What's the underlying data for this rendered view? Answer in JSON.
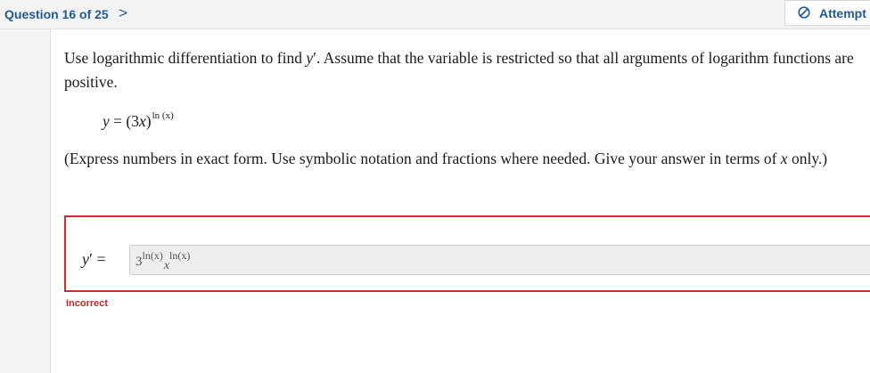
{
  "header": {
    "question_counter": "Question 16 of 25",
    "next_icon": "chevron-right-icon",
    "next_glyph": ">",
    "attempt_icon": "prohibited-icon",
    "attempt_label": "Attempt"
  },
  "question": {
    "prompt_part1": "Use logarithmic differentiation to find ",
    "prompt_var": "y",
    "prompt_prime": "′",
    "prompt_part2": ". Assume that the variable is restricted so that all arguments of logarithm functions are positive.",
    "equation_lhs": "y",
    "equation_eq": " = (3",
    "equation_x": "x",
    "equation_close": ")",
    "equation_exponent": "ln (x)",
    "instructions_part1": "(Express numbers in exact form. Use symbolic notation and fractions where needed. Give your answer in terms of ",
    "instructions_var": "x",
    "instructions_part2": " only.)"
  },
  "answer": {
    "label_var": "y",
    "label_rest": "′ =",
    "base": "3",
    "base_exponent": "ln(x)",
    "x_sub": "x",
    "x_exponent": "ln(x)",
    "status": "Incorrect"
  },
  "colors": {
    "accent": "#1f5a94",
    "error": "#d42b2b",
    "input_bg": "#eeeeee"
  }
}
